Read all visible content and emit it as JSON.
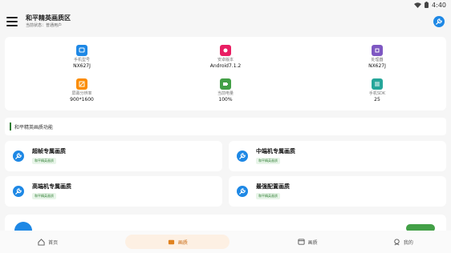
{
  "status_bar": {
    "time": "4:40"
  },
  "app_bar": {
    "title": "和平精英画质区",
    "subtitle": "当前状态：普通用户"
  },
  "device_info": [
    {
      "icon": "phone-icon",
      "label": "手机型号",
      "value": "NX627J",
      "color": "#1e88e5"
    },
    {
      "icon": "android-icon",
      "label": "安卓版本",
      "value": "Android7.1.2",
      "color": "#e91e63"
    },
    {
      "icon": "chip-icon",
      "label": "处理器",
      "value": "NX627J",
      "color": "#7e57c2"
    },
    {
      "icon": "resolution-icon",
      "label": "屏幕分辨率",
      "value": "900*1600",
      "color": "#fb8c00"
    },
    {
      "icon": "battery-icon",
      "label": "当前电量",
      "value": "100%",
      "color": "#43a047"
    },
    {
      "icon": "sliders-icon",
      "label": "手机SDK",
      "value": "25",
      "color": "#26a69a"
    }
  ],
  "section": {
    "title": "和平精英画质功能"
  },
  "functions": [
    {
      "title": "超帧专属画质",
      "tag": "和平精英画质"
    },
    {
      "title": "中端机专属画质",
      "tag": "和平精英画质"
    },
    {
      "title": "高端机专属画质",
      "tag": "和平精英画质"
    },
    {
      "title": "最强配置画质",
      "tag": "和平精英画质"
    }
  ],
  "bottom_nav": [
    {
      "icon": "home-icon",
      "label": "首页"
    },
    {
      "icon": "quality-icon",
      "label": "画质"
    },
    {
      "icon": "monitor-icon",
      "label": "画质"
    },
    {
      "icon": "user-icon",
      "label": "我的"
    }
  ]
}
